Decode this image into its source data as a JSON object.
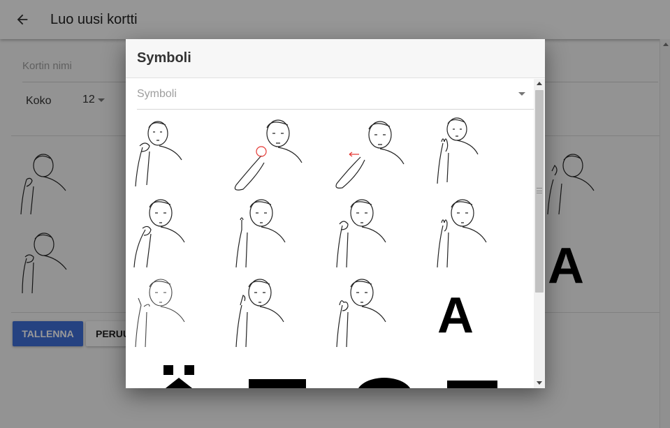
{
  "appbar": {
    "back_icon": "arrow-left-icon",
    "title": "Luo uusi kortti"
  },
  "form": {
    "name_placeholder": "Kortin nimi",
    "name_value": "",
    "size_label": "Koko",
    "size_value": "12",
    "background_letter": "A"
  },
  "actions": {
    "save_label": "TALLENNA",
    "cancel_label": "PERUUTA"
  },
  "dialog": {
    "title": "Symboli",
    "select_placeholder": "Symboli",
    "letters": [
      "A"
    ]
  },
  "colors": {
    "primary": "#3f6fd8",
    "scrim": "rgba(0,0,0,0.4)",
    "marker_red": "#e53935"
  }
}
